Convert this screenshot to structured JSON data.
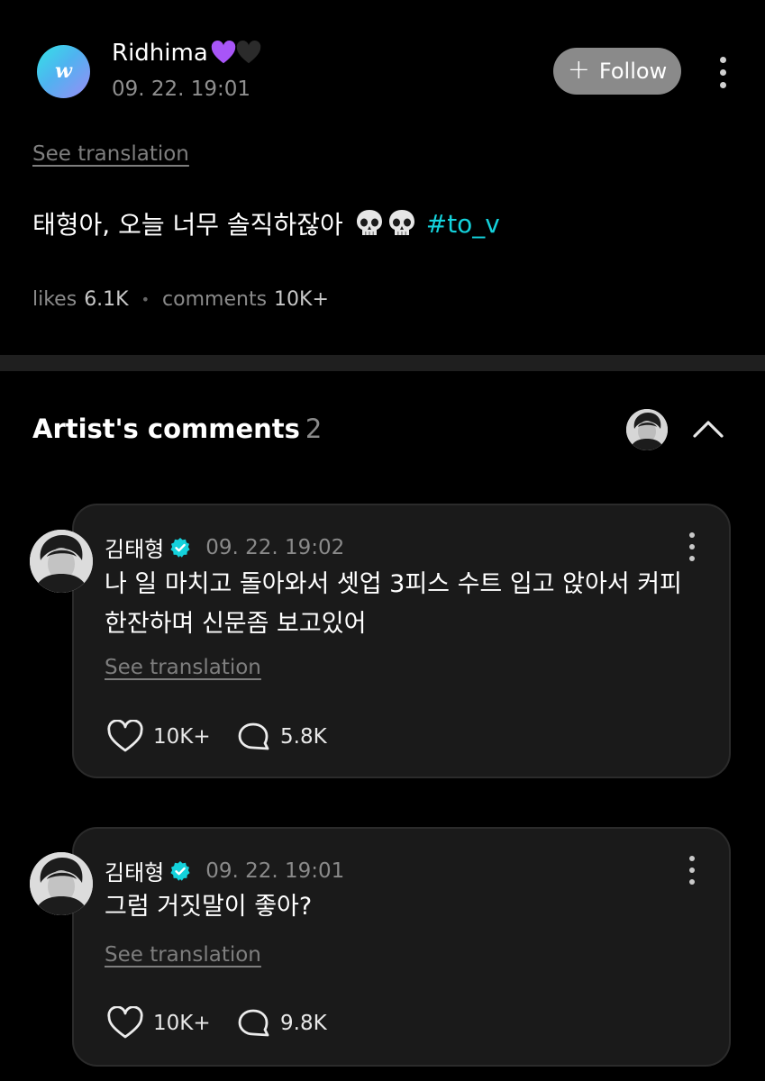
{
  "post": {
    "avatar_letter": "w",
    "author": "Ridhima",
    "author_hearts": [
      "purple-heart-icon",
      "black-heart-icon"
    ],
    "timestamp": "09. 22. 19:01",
    "follow_label": "Follow",
    "see_translation": "See translation",
    "body_text": "태형아, 오늘 너무 솔직하잖아",
    "body_emojis": [
      "skull-icon",
      "skull-icon"
    ],
    "hashtag": "#to_v",
    "likes_label": "likes",
    "likes_value": "6.1K",
    "comments_label": "comments",
    "comments_value": "10K+"
  },
  "artist_comments": {
    "title": "Artist's comments",
    "count": "2",
    "items": [
      {
        "author": "김태형",
        "timestamp": "09. 22. 19:02",
        "text": "나 일 마치고 돌아와서 셋업 3피스 수트 입고 앉아서 커피 한잔하며 신문좀 보고있어",
        "see_translation": "See translation",
        "likes": "10K+",
        "replies": "5.8K"
      },
      {
        "author": "김태형",
        "timestamp": "09. 22. 19:01",
        "text": "그럼 거짓말이 좋아?",
        "see_translation": "See translation",
        "likes": "10K+",
        "replies": "9.8K"
      }
    ]
  },
  "colors": {
    "background": "#000000",
    "card": "#1a1a1a",
    "hashtag": "#14d2dc",
    "verified": "#14d2dc",
    "follow_button": "#8a8a8a",
    "divider": "#1f1f1f"
  }
}
